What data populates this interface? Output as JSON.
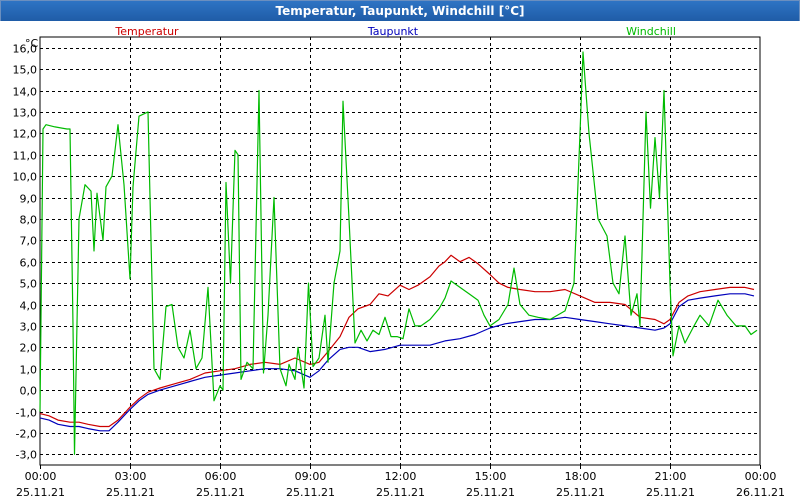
{
  "window": {
    "title": "Temperatur, Taupunkt, Windchill [°C]"
  },
  "chart_data": {
    "type": "line",
    "title": "Temperatur, Taupunkt, Windchill [°C]",
    "ylabel": "°C",
    "ylim": [
      -3.5,
      16.5
    ],
    "yticks": [
      16,
      15,
      14,
      13,
      12,
      11,
      10,
      9,
      8,
      7,
      6,
      5,
      4,
      3,
      2,
      1,
      0,
      -1,
      -2,
      -3
    ],
    "ytick_labels": [
      "16,0",
      "15,0",
      "14,0",
      "13,0",
      "12,0",
      "11,0",
      "10,0",
      "9,0",
      "8,0",
      "7,0",
      "6,0",
      "5,0",
      "4,0",
      "3,0",
      "2,0",
      "1,0",
      "0,0",
      "-1,0",
      "-2,0",
      "-3,0"
    ],
    "xlim": [
      0,
      24
    ],
    "xticks": [
      0,
      3,
      6,
      9,
      12,
      15,
      18,
      21,
      24
    ],
    "xtick_time_labels": [
      "00:00",
      "03:00",
      "06:00",
      "09:00",
      "12:00",
      "15:00",
      "18:00",
      "21:00",
      "00:00"
    ],
    "xtick_date_labels": [
      "25.11.21",
      "25.11.21",
      "25.11.21",
      "25.11.21",
      "25.11.21",
      "25.11.21",
      "25.11.21",
      "25.11.21",
      "26.11.21"
    ],
    "grid": true,
    "legend_position": "top",
    "series": [
      {
        "name": "Temperatur",
        "color": "#cc0000",
        "points": [
          [
            0,
            -1.1
          ],
          [
            0.3,
            -1.2
          ],
          [
            0.6,
            -1.4
          ],
          [
            1,
            -1.5
          ],
          [
            1.3,
            -1.5
          ],
          [
            1.6,
            -1.6
          ],
          [
            2,
            -1.7
          ],
          [
            2.3,
            -1.7
          ],
          [
            2.6,
            -1.4
          ],
          [
            3,
            -0.8
          ],
          [
            3.3,
            -0.4
          ],
          [
            3.6,
            -0.1
          ],
          [
            4,
            0.1
          ],
          [
            4.5,
            0.3
          ],
          [
            5,
            0.5
          ],
          [
            5.5,
            0.8
          ],
          [
            6,
            0.9
          ],
          [
            6.5,
            1.0
          ],
          [
            7,
            1.2
          ],
          [
            7.5,
            1.3
          ],
          [
            8,
            1.2
          ],
          [
            8.5,
            1.5
          ],
          [
            9,
            1.2
          ],
          [
            9.3,
            1.3
          ],
          [
            9.6,
            1.8
          ],
          [
            10,
            2.5
          ],
          [
            10.3,
            3.4
          ],
          [
            10.6,
            3.8
          ],
          [
            11,
            4.0
          ],
          [
            11.3,
            4.5
          ],
          [
            11.6,
            4.4
          ],
          [
            12,
            4.9
          ],
          [
            12.3,
            4.7
          ],
          [
            12.6,
            4.9
          ],
          [
            13,
            5.3
          ],
          [
            13.3,
            5.8
          ],
          [
            13.5,
            6.0
          ],
          [
            13.7,
            6.3
          ],
          [
            14,
            6.0
          ],
          [
            14.3,
            6.2
          ],
          [
            14.6,
            5.9
          ],
          [
            15,
            5.4
          ],
          [
            15.3,
            5.0
          ],
          [
            15.6,
            4.8
          ],
          [
            16,
            4.7
          ],
          [
            16.5,
            4.6
          ],
          [
            17,
            4.6
          ],
          [
            17.5,
            4.7
          ],
          [
            18,
            4.4
          ],
          [
            18.5,
            4.1
          ],
          [
            19,
            4.1
          ],
          [
            19.5,
            4.0
          ],
          [
            20,
            3.4
          ],
          [
            20.5,
            3.3
          ],
          [
            20.8,
            3.1
          ],
          [
            21,
            3.3
          ],
          [
            21.3,
            4.1
          ],
          [
            21.6,
            4.4
          ],
          [
            22,
            4.6
          ],
          [
            22.5,
            4.7
          ],
          [
            23,
            4.8
          ],
          [
            23.5,
            4.8
          ],
          [
            23.8,
            4.7
          ]
        ]
      },
      {
        "name": "Taupunkt",
        "color": "#0000bb",
        "points": [
          [
            0,
            -1.3
          ],
          [
            0.3,
            -1.4
          ],
          [
            0.6,
            -1.6
          ],
          [
            1,
            -1.7
          ],
          [
            1.3,
            -1.7
          ],
          [
            1.6,
            -1.8
          ],
          [
            2,
            -1.9
          ],
          [
            2.3,
            -1.9
          ],
          [
            2.6,
            -1.5
          ],
          [
            3,
            -0.9
          ],
          [
            3.3,
            -0.5
          ],
          [
            3.6,
            -0.2
          ],
          [
            4,
            0.0
          ],
          [
            4.5,
            0.2
          ],
          [
            5,
            0.4
          ],
          [
            5.5,
            0.6
          ],
          [
            6,
            0.7
          ],
          [
            6.5,
            0.8
          ],
          [
            7,
            0.9
          ],
          [
            7.5,
            1.0
          ],
          [
            8,
            1.0
          ],
          [
            8.5,
            0.9
          ],
          [
            9,
            0.6
          ],
          [
            9.3,
            0.9
          ],
          [
            9.6,
            1.4
          ],
          [
            10,
            1.9
          ],
          [
            10.3,
            2.0
          ],
          [
            10.6,
            2.0
          ],
          [
            11,
            1.8
          ],
          [
            11.5,
            1.9
          ],
          [
            12,
            2.1
          ],
          [
            12.5,
            2.1
          ],
          [
            13,
            2.1
          ],
          [
            13.5,
            2.3
          ],
          [
            14,
            2.4
          ],
          [
            14.5,
            2.6
          ],
          [
            15,
            2.9
          ],
          [
            15.5,
            3.1
          ],
          [
            16,
            3.2
          ],
          [
            16.5,
            3.3
          ],
          [
            17,
            3.3
          ],
          [
            17.5,
            3.4
          ],
          [
            18,
            3.3
          ],
          [
            18.5,
            3.2
          ],
          [
            19,
            3.1
          ],
          [
            19.5,
            3.0
          ],
          [
            20,
            2.9
          ],
          [
            20.5,
            2.8
          ],
          [
            20.8,
            2.9
          ],
          [
            21,
            3.1
          ],
          [
            21.3,
            3.9
          ],
          [
            21.6,
            4.2
          ],
          [
            22,
            4.3
          ],
          [
            22.5,
            4.4
          ],
          [
            23,
            4.5
          ],
          [
            23.5,
            4.5
          ],
          [
            23.8,
            4.4
          ]
        ]
      },
      {
        "name": "Windchill",
        "color": "#00bb00",
        "points": [
          [
            0,
            -1.0
          ],
          [
            0.1,
            12.2
          ],
          [
            0.2,
            12.4
          ],
          [
            0.5,
            12.3
          ],
          [
            0.9,
            12.2
          ],
          [
            1.0,
            12.2
          ],
          [
            1.1,
            3.0
          ],
          [
            1.15,
            -3.0
          ],
          [
            1.3,
            8.0
          ],
          [
            1.5,
            9.6
          ],
          [
            1.7,
            9.3
          ],
          [
            1.8,
            6.5
          ],
          [
            1.9,
            9.2
          ],
          [
            2.1,
            7.0
          ],
          [
            2.2,
            9.5
          ],
          [
            2.4,
            10.0
          ],
          [
            2.6,
            12.4
          ],
          [
            2.8,
            9.6
          ],
          [
            3.0,
            5.2
          ],
          [
            3.1,
            9.5
          ],
          [
            3.3,
            12.8
          ],
          [
            3.6,
            13.0
          ],
          [
            3.8,
            1.0
          ],
          [
            4.0,
            0.5
          ],
          [
            4.2,
            3.9
          ],
          [
            4.4,
            4.0
          ],
          [
            4.6,
            2.0
          ],
          [
            4.8,
            1.5
          ],
          [
            5.0,
            2.8
          ],
          [
            5.2,
            1.0
          ],
          [
            5.4,
            1.5
          ],
          [
            5.6,
            4.8
          ],
          [
            5.8,
            -0.5
          ],
          [
            6.0,
            0.2
          ],
          [
            6.1,
            0.0
          ],
          [
            6.2,
            9.7
          ],
          [
            6.35,
            5.0
          ],
          [
            6.5,
            11.2
          ],
          [
            6.6,
            11.0
          ],
          [
            6.7,
            0.5
          ],
          [
            6.9,
            1.3
          ],
          [
            7.1,
            1.0
          ],
          [
            7.3,
            14.0
          ],
          [
            7.45,
            0.8
          ],
          [
            7.6,
            3.5
          ],
          [
            7.8,
            9.0
          ],
          [
            8.0,
            1.0
          ],
          [
            8.2,
            0.2
          ],
          [
            8.3,
            1.2
          ],
          [
            8.5,
            0.5
          ],
          [
            8.6,
            2.0
          ],
          [
            8.8,
            0.1
          ],
          [
            8.95,
            5.0
          ],
          [
            9.1,
            1.1
          ],
          [
            9.3,
            1.5
          ],
          [
            9.5,
            3.5
          ],
          [
            9.6,
            1.3
          ],
          [
            9.8,
            5.0
          ],
          [
            10.0,
            6.5
          ],
          [
            10.1,
            13.5
          ],
          [
            10.3,
            8.0
          ],
          [
            10.5,
            2.2
          ],
          [
            10.7,
            2.8
          ],
          [
            10.9,
            2.3
          ],
          [
            11.1,
            2.8
          ],
          [
            11.3,
            2.6
          ],
          [
            11.5,
            3.4
          ],
          [
            11.7,
            2.5
          ],
          [
            11.9,
            2.5
          ],
          [
            12.1,
            2.4
          ],
          [
            12.3,
            3.8
          ],
          [
            12.5,
            3.0
          ],
          [
            12.7,
            3.0
          ],
          [
            13.0,
            3.3
          ],
          [
            13.3,
            3.8
          ],
          [
            13.5,
            4.3
          ],
          [
            13.7,
            5.1
          ],
          [
            14.0,
            4.8
          ],
          [
            14.3,
            4.5
          ],
          [
            14.6,
            4.2
          ],
          [
            14.8,
            3.5
          ],
          [
            15.0,
            3.0
          ],
          [
            15.3,
            3.3
          ],
          [
            15.6,
            4.0
          ],
          [
            15.8,
            5.7
          ],
          [
            16.0,
            4.0
          ],
          [
            16.3,
            3.5
          ],
          [
            16.6,
            3.4
          ],
          [
            17.0,
            3.3
          ],
          [
            17.5,
            3.7
          ],
          [
            17.8,
            5.0
          ],
          [
            18.0,
            12.0
          ],
          [
            18.1,
            15.8
          ],
          [
            18.3,
            12.0
          ],
          [
            18.6,
            8.0
          ],
          [
            18.9,
            7.2
          ],
          [
            19.1,
            5.0
          ],
          [
            19.3,
            4.5
          ],
          [
            19.5,
            7.2
          ],
          [
            19.7,
            3.5
          ],
          [
            19.9,
            4.5
          ],
          [
            20.0,
            3.0
          ],
          [
            20.2,
            13.0
          ],
          [
            20.35,
            8.5
          ],
          [
            20.5,
            11.8
          ],
          [
            20.65,
            9.0
          ],
          [
            20.8,
            14.0
          ],
          [
            21.0,
            5.0
          ],
          [
            21.1,
            1.6
          ],
          [
            21.3,
            3.0
          ],
          [
            21.5,
            2.2
          ],
          [
            21.8,
            3.0
          ],
          [
            22.0,
            3.5
          ],
          [
            22.3,
            3.0
          ],
          [
            22.6,
            4.2
          ],
          [
            22.9,
            3.5
          ],
          [
            23.2,
            3.0
          ],
          [
            23.5,
            3.0
          ],
          [
            23.7,
            2.6
          ],
          [
            23.9,
            2.8
          ]
        ]
      }
    ]
  }
}
